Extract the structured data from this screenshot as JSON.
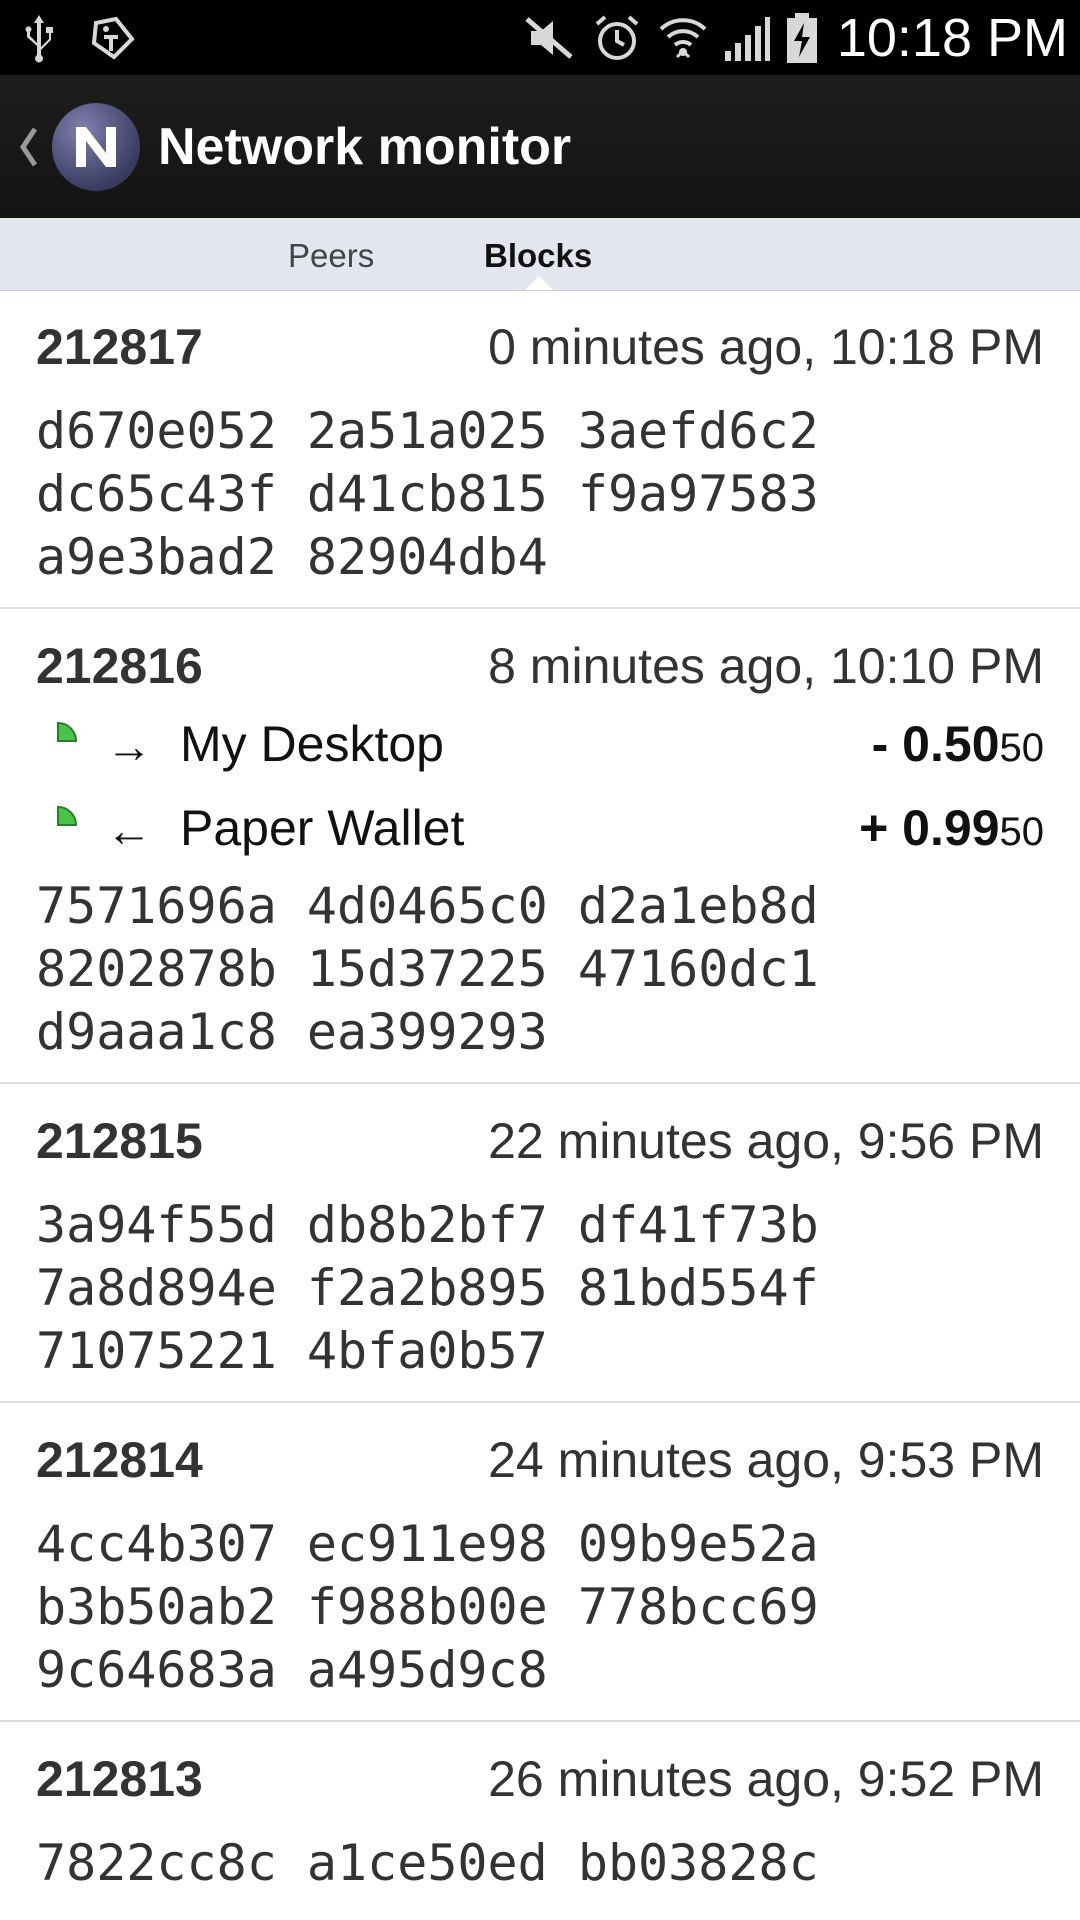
{
  "status_bar": {
    "time": "10:18 PM",
    "icons": [
      "usb-icon",
      "tag-icon",
      "mute-icon",
      "alarm-icon",
      "wifi-icon",
      "signal-icon",
      "battery-charging-icon"
    ]
  },
  "action_bar": {
    "title": "Network monitor",
    "logo_letter": "N"
  },
  "tabs": [
    {
      "label": "Peers",
      "selected": false
    },
    {
      "label": "Blocks",
      "selected": true
    }
  ],
  "colors": {
    "tab_bar": "#e4e6ef",
    "action_bar": "#1a1a1a",
    "tx_indicator": "#4ac34a"
  },
  "blocks": [
    {
      "height": "212817",
      "time": "0 minutes ago, 10:18 PM",
      "hash": [
        "d670e052 2a51a025 3aefd6c2",
        "dc65c43f d41cb815 f9a97583",
        "a9e3bad2 82904db4"
      ],
      "transactions": []
    },
    {
      "height": "212816",
      "time": "8 minutes ago, 10:10 PM",
      "hash": [
        "7571696a 4d0465c0 d2a1eb8d",
        "8202878b 15d37225 47160dc1",
        "d9aaa1c8 ea399293"
      ],
      "transactions": [
        {
          "arrow": "→",
          "label": "My Desktop",
          "amount_main": "- 0.50",
          "amount_small": "50"
        },
        {
          "arrow": "←",
          "label": "Paper Wallet",
          "amount_main": "+ 0.99",
          "amount_small": "50"
        }
      ]
    },
    {
      "height": "212815",
      "time": "22 minutes ago, 9:56 PM",
      "hash": [
        "3a94f55d db8b2bf7 df41f73b",
        "7a8d894e f2a2b895 81bd554f",
        "71075221 4bfa0b57"
      ],
      "transactions": []
    },
    {
      "height": "212814",
      "time": "24 minutes ago, 9:53 PM",
      "hash": [
        "4cc4b307 ec911e98 09b9e52a",
        "b3b50ab2 f988b00e 778bcc69",
        "9c64683a a495d9c8"
      ],
      "transactions": []
    },
    {
      "height": "212813",
      "time": "26 minutes ago, 9:52 PM",
      "hash": [
        "7822cc8c a1ce50ed bb03828c"
      ],
      "transactions": []
    }
  ]
}
